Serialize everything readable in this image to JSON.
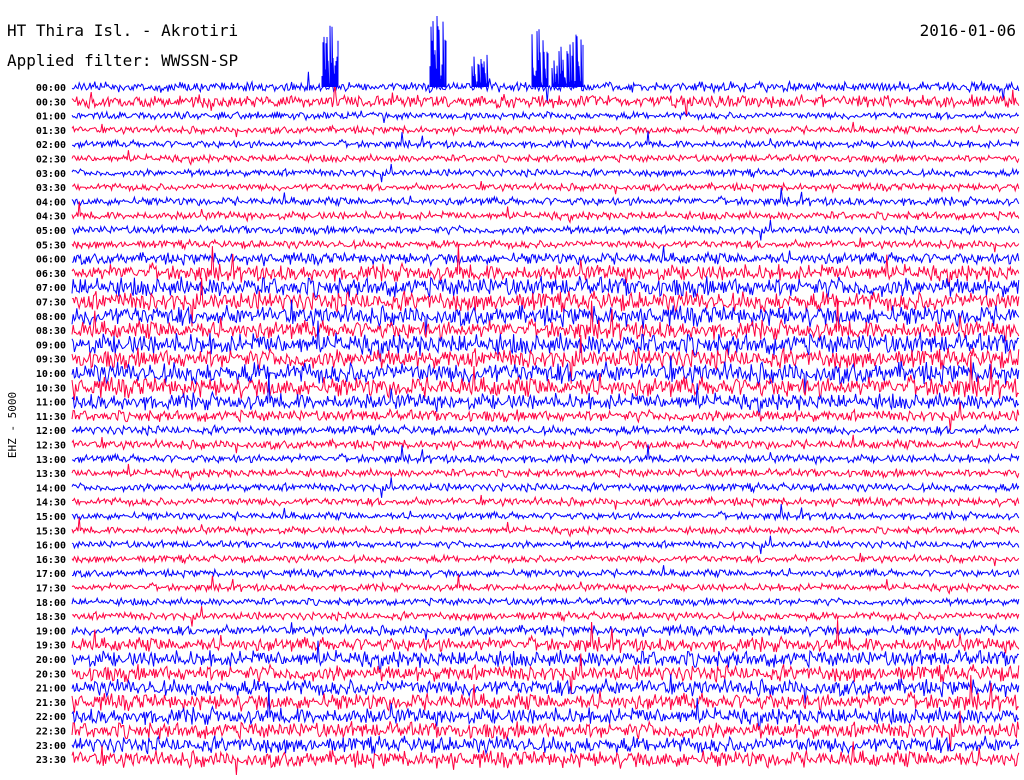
{
  "header": {
    "station": "HT Thira Isl. - Akrotiri",
    "date": "2016-01-06",
    "filter": "Applied filter: WWSSN-SP"
  },
  "chart_data": {
    "type": "line",
    "ylabel": "EHZ - 5000",
    "row_labels": [
      "00:00",
      "00:30",
      "01:00",
      "01:30",
      "02:00",
      "02:30",
      "03:00",
      "03:30",
      "04:00",
      "04:30",
      "05:00",
      "05:30",
      "06:00",
      "06:30",
      "07:00",
      "07:30",
      "08:00",
      "08:30",
      "09:00",
      "09:30",
      "10:00",
      "10:30",
      "11:00",
      "11:30",
      "12:00",
      "12:30",
      "13:00",
      "13:30",
      "14:00",
      "14:30",
      "15:00",
      "15:30",
      "16:00",
      "16:30",
      "17:00",
      "17:30",
      "18:00",
      "18:30",
      "19:00",
      "19:30",
      "20:00",
      "20:30",
      "21:00",
      "21:30",
      "22:00",
      "22:30",
      "23:00",
      "23:30"
    ],
    "trace_colors": [
      "#0000ff",
      "#ff0040"
    ],
    "rows_per_trace_period": 48,
    "row_noise_level": [
      0.6,
      0.75,
      0.45,
      0.45,
      0.45,
      0.45,
      0.45,
      0.45,
      0.5,
      0.5,
      0.5,
      0.5,
      0.7,
      1.0,
      1.2,
      1.2,
      1.2,
      1.1,
      1.3,
      1.2,
      1.3,
      1.2,
      1.0,
      0.7,
      0.55,
      0.55,
      0.5,
      0.5,
      0.5,
      0.5,
      0.45,
      0.45,
      0.45,
      0.45,
      0.45,
      0.45,
      0.45,
      0.5,
      0.6,
      0.85,
      1.0,
      1.0,
      1.0,
      1.0,
      1.0,
      1.0,
      1.0,
      1.0
    ]
  }
}
